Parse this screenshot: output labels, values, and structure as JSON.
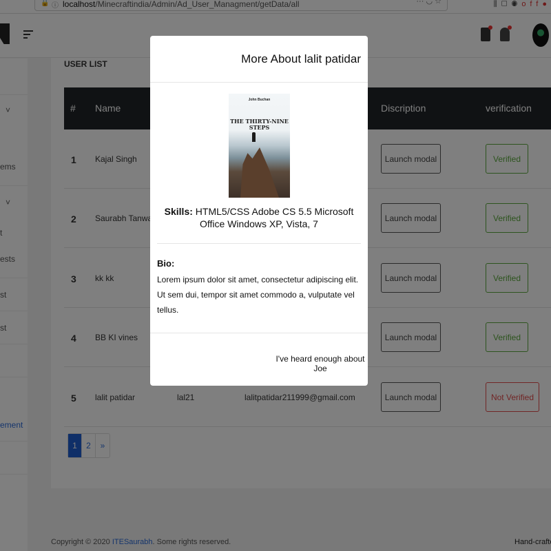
{
  "browser": {
    "url_host": "localhost",
    "url_path": "/Minecraftindia/Admin/Ad_User_Managment/getData/all",
    "ext_badge": "off"
  },
  "sidebar": {
    "items": [
      {
        "label": "˅"
      },
      {
        "label": "ems"
      },
      {
        "label": "˅"
      },
      {
        "label": "t"
      },
      {
        "label": "ests"
      },
      {
        "label": "st"
      },
      {
        "label": "st"
      },
      {
        "label": "ement"
      }
    ]
  },
  "main": {
    "title": "USER LIST",
    "columns": [
      "#",
      "Name",
      "Discription",
      "verification"
    ],
    "rows": [
      {
        "idx": "1",
        "name": "Kajal Singh",
        "username": "",
        "email": "",
        "launch": "Launch modal",
        "status": "Verified"
      },
      {
        "idx": "2",
        "name": "Saurabh Tanwar",
        "username": "",
        "email": "",
        "launch": "Launch modal",
        "status": "Verified"
      },
      {
        "idx": "3",
        "name": "kk kk",
        "username": "",
        "email": "",
        "launch": "Launch modal",
        "status": "Verified"
      },
      {
        "idx": "4",
        "name": "BB KI vines",
        "username": "",
        "email": "",
        "launch": "Launch modal",
        "status": "Verified"
      },
      {
        "idx": "5",
        "name": "lalit patidar",
        "username": "lal21",
        "email": "lalitpatidar211999@gmail.com",
        "launch": "Launch modal",
        "status": "Not Verified"
      }
    ],
    "pagination": [
      "1",
      "2",
      "»"
    ]
  },
  "footer": {
    "copyright_prefix": "Copyright © 2020 ",
    "copyright_link": "ITESaurabh",
    "copyright_suffix": ". Some rights reserved.",
    "right_text": "Hand-crafted &"
  },
  "modal": {
    "title": "More About lalit patidar",
    "book_author": "John Buchan",
    "book_title": "THE THIRTY-NINE STEPS",
    "skills_label": "Skills:",
    "skills_value": " HTML5/CSS Adobe CS 5.5 Microsoft Office Windows XP, Vista, 7",
    "bio_label": "Bio:",
    "bio_text": "Lorem ipsum dolor sit amet, consectetur adipiscing elit. Ut sem dui, tempor sit amet commodo a, vulputate vel tellus.",
    "footer_button": "I've heard enough about Joe"
  },
  "colors": {
    "primary": "#1f5fd0",
    "success": "#5aa83c",
    "danger": "#e24b4b",
    "table_header": "#212529"
  }
}
